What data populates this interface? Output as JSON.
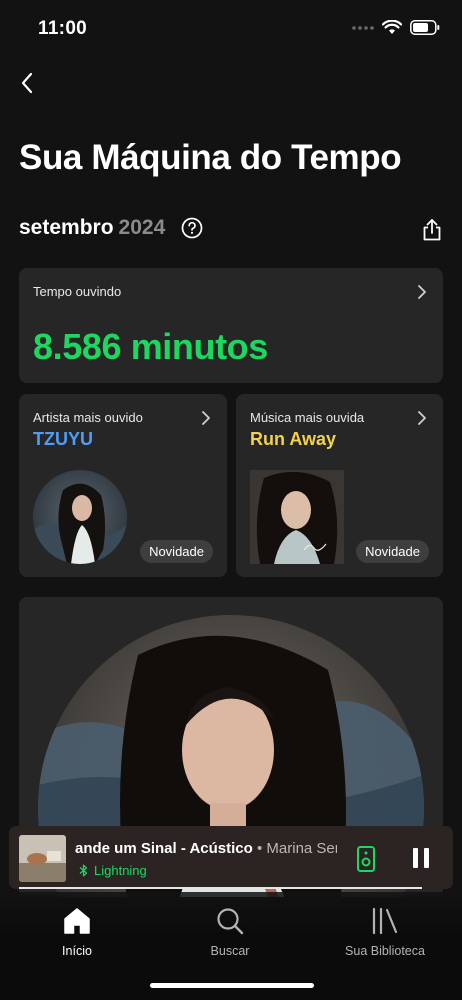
{
  "status": {
    "time": "11:00"
  },
  "page": {
    "title": "Sua Máquina do Tempo"
  },
  "period": {
    "month": "setembro",
    "year": "2024"
  },
  "listening_time": {
    "label": "Tempo ouvindo",
    "value": "8.586 minutos"
  },
  "top_artist": {
    "label": "Artista mais ouvido",
    "name": "TZUYU",
    "badge": "Novidade"
  },
  "top_song": {
    "label": "Música mais ouvida",
    "name": "Run Away",
    "badge": "Novidade"
  },
  "now_playing": {
    "title": "ande um Sinal - Acústico",
    "separator": " • ",
    "artist": "Marina Sena",
    "device": "Lightning",
    "progress": 0.95
  },
  "nav": {
    "home": "Início",
    "search": "Buscar",
    "library": "Sua Biblioteca"
  },
  "colors": {
    "accent_green": "#1ed760",
    "artist_blue": "#4f9cf9",
    "song_yellow": "#f2d14b",
    "background": "#121212",
    "card": "#262626"
  },
  "icons": [
    "back-chevron-icon",
    "help-circle-icon",
    "share-icon",
    "chevron-right-icon",
    "bluetooth-icon",
    "speaker-icon",
    "pause-icon",
    "home-icon",
    "search-icon",
    "library-icon"
  ]
}
